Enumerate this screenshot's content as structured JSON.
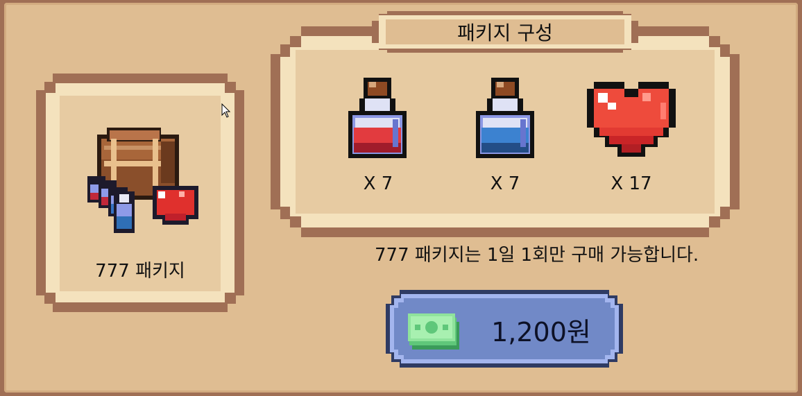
{
  "package": {
    "name": "777 패키지",
    "icon": "treasure-chest-bundle-icon"
  },
  "composition": {
    "title": "패키지 구성",
    "items": [
      {
        "icon": "red-potion-icon",
        "label": "X 7"
      },
      {
        "icon": "blue-potion-icon",
        "label": "X 7"
      },
      {
        "icon": "heart-icon",
        "label": "X 17"
      }
    ]
  },
  "notice": "777 패키지는 1일 1회만 구매 가능합니다.",
  "purchase": {
    "price": "1,200원",
    "icon": "cash-icon"
  },
  "colors": {
    "panel": "#dfbd92",
    "border": "#a06f55",
    "button": "#7189c7",
    "button_border": "#2f3b63"
  }
}
